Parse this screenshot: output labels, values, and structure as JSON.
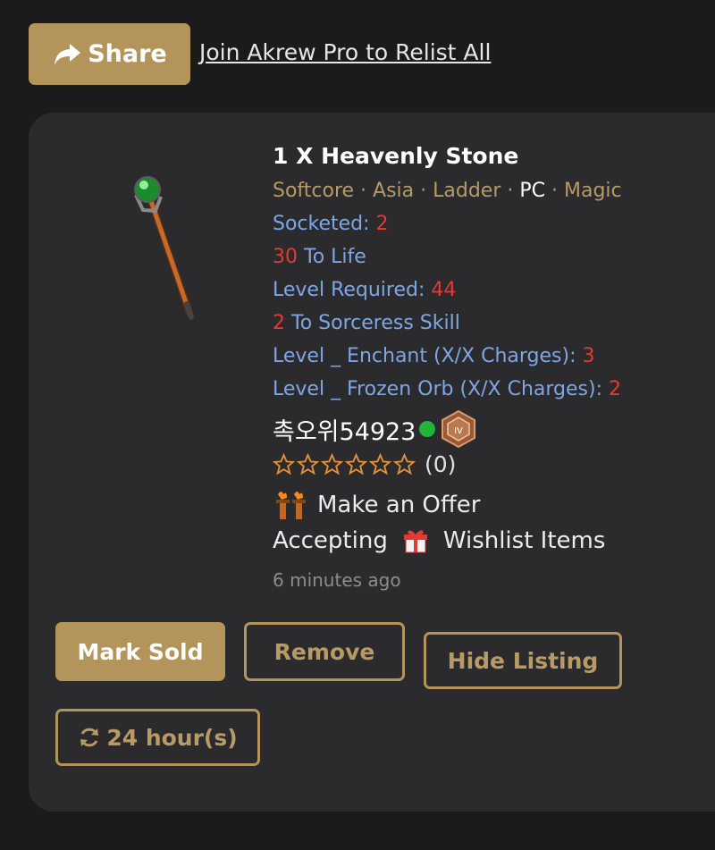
{
  "header": {
    "share_label": "Share",
    "relist_link": "Join Akrew Pro to Relist All"
  },
  "listing": {
    "title": "1 X Heavenly Stone",
    "tags": {
      "mode": "Softcore",
      "region": "Asia",
      "ladder": "Ladder",
      "platform": "PC",
      "rarity": "Magic",
      "separator": " · "
    },
    "stats": [
      {
        "pre": "",
        "label": "Socketed: ",
        "value": "2"
      },
      {
        "pre": "30",
        "label": " To Life",
        "value": ""
      },
      {
        "pre": "",
        "label": "Level Required: ",
        "value": "44"
      },
      {
        "pre": "2",
        "label": " To Sorceress Skill",
        "value": ""
      },
      {
        "pre": "",
        "label": "Level _ Enchant (X/X Charges): ",
        "value": "3"
      },
      {
        "pre": "",
        "label": "Level _ Frozen Orb (X/X Charges): ",
        "value": "2"
      }
    ],
    "seller": {
      "name": "촉오위54923",
      "online": true
    },
    "rating": {
      "stars_filled": 0,
      "stars_total": 6,
      "count": "(0)"
    },
    "offer_text": "Make an Offer",
    "accepting_label": "Accepting",
    "wishlist_label": "Wishlist Items",
    "time_ago": "6 minutes ago"
  },
  "actions": {
    "mark_sold": "Mark Sold",
    "remove": "Remove",
    "hide": "Hide Listing",
    "duration": "24 hour(s)"
  },
  "colors": {
    "accent": "#b3945a",
    "stat_blue": "#7fa6e4",
    "stat_red": "#e23b32",
    "online": "#22b43b",
    "background": "#1b1b1c",
    "card": "#2b2b2d"
  },
  "icons": [
    "share-arrow-icon",
    "staff-item-icon",
    "online-status-icon",
    "bronze-rank-badge-icon",
    "star-outline-icon",
    "torch-offer-icon",
    "gift-icon",
    "refresh-icon"
  ]
}
